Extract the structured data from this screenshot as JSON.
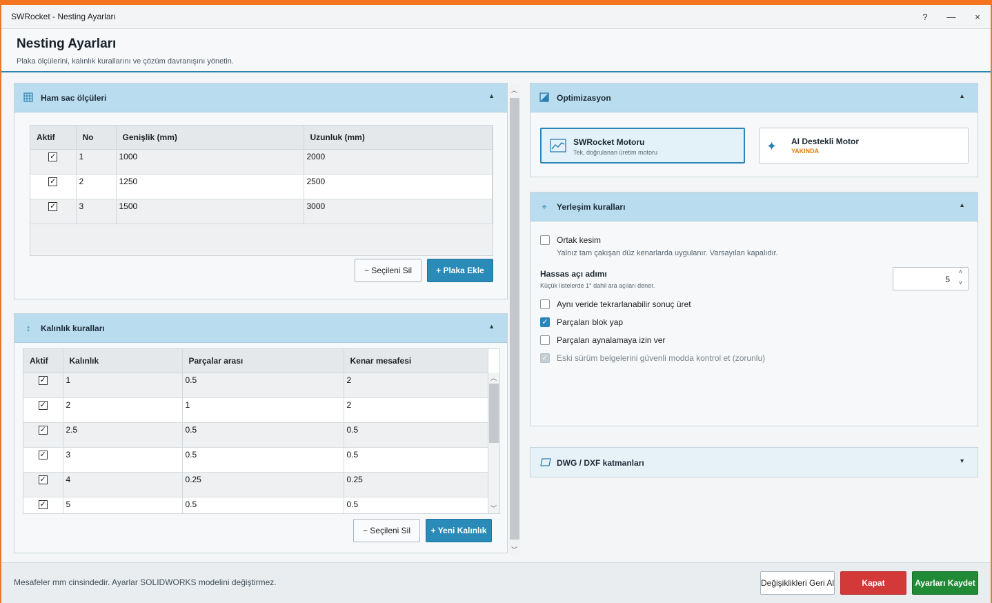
{
  "window": {
    "title": "SWRocket - Nesting Ayarları",
    "help": "?",
    "minimize": "—",
    "close": "×"
  },
  "header": {
    "title": "Nesting Ayarları",
    "subtitle": "Plaka ölçülerini, kalınlık kurallarını ve çözüm davranışını yönetin."
  },
  "sheets": {
    "title": "Ham sac ölçüleri",
    "columns": [
      "Aktif",
      "No",
      "Genişlik (mm)",
      "Uzunluk (mm)"
    ],
    "rows": [
      {
        "active": true,
        "no": "1",
        "width": "1000",
        "length": "2000"
      },
      {
        "active": true,
        "no": "2",
        "width": "1250",
        "length": "2500"
      },
      {
        "active": true,
        "no": "3",
        "width": "1500",
        "length": "3000"
      }
    ],
    "delete_label": "−  Seçileni Sil",
    "add_label": "+  Plaka Ekle"
  },
  "thickness": {
    "title": "Kalınlık kuralları",
    "columns": [
      "Aktif",
      "Kalınlık",
      "Parçalar arası",
      "Kenar mesafesi"
    ],
    "rows": [
      {
        "active": true,
        "thickness": "1",
        "gap": "0.5",
        "edge": "2"
      },
      {
        "active": true,
        "thickness": "2",
        "gap": "1",
        "edge": "2"
      },
      {
        "active": true,
        "thickness": "2.5",
        "gap": "0.5",
        "edge": "0.5"
      },
      {
        "active": true,
        "thickness": "3",
        "gap": "0.5",
        "edge": "0.5"
      },
      {
        "active": true,
        "thickness": "4",
        "gap": "0.25",
        "edge": "0.25"
      },
      {
        "active": true,
        "thickness": "5",
        "gap": "0.5",
        "edge": "0.5"
      }
    ],
    "delete_label": "−  Seçileni Sil",
    "add_label": "+  Yeni Kalınlık"
  },
  "optimization": {
    "title": "Optimizasyon",
    "engine1": {
      "name": "SWRocket Motoru",
      "desc": "Tek, doğrulanan üretim motoru"
    },
    "engine2": {
      "name": "AI Destekli Motor",
      "badge": "YAKINDA"
    }
  },
  "placement": {
    "title": "Yerleşim kuralları",
    "common_cut": {
      "label": "Ortak kesim",
      "checked": false,
      "hint": "Yalnız tam çakışan düz kenarlarda uygulanır. Varsayılan kapalıdır."
    },
    "angle_step": {
      "label": "Hassas açı adımı",
      "hint": "Küçük listelerde 1° dahil ara açıları dener.",
      "value": "5"
    },
    "options": [
      {
        "label": "Aynı veride tekrarlanabilir sonuç üret",
        "checked": false,
        "disabled": false
      },
      {
        "label": "Parçaları blok yap",
        "checked": true,
        "disabled": false
      },
      {
        "label": "Parçaları aynalamaya izin ver",
        "checked": false,
        "disabled": false
      },
      {
        "label": "Eski sürüm belgelerini güvenli modda kontrol et (zorunlu)",
        "checked": true,
        "disabled": true
      }
    ]
  },
  "layers": {
    "title": "DWG / DXF katmanları"
  },
  "footer": {
    "note": "Mesafeler mm cinsindedir. Ayarlar SOLIDWORKS modelini değiştirmez.",
    "revert_label": "Değişiklikleri Geri Al",
    "close_label": "Kapat",
    "save_label": "Ayarları Kaydet"
  },
  "colors": {
    "accent": "#2a8ab8",
    "title_border": "#f4741f",
    "danger": "#d4393a",
    "success": "#218a36",
    "badge": "#d87c12"
  }
}
